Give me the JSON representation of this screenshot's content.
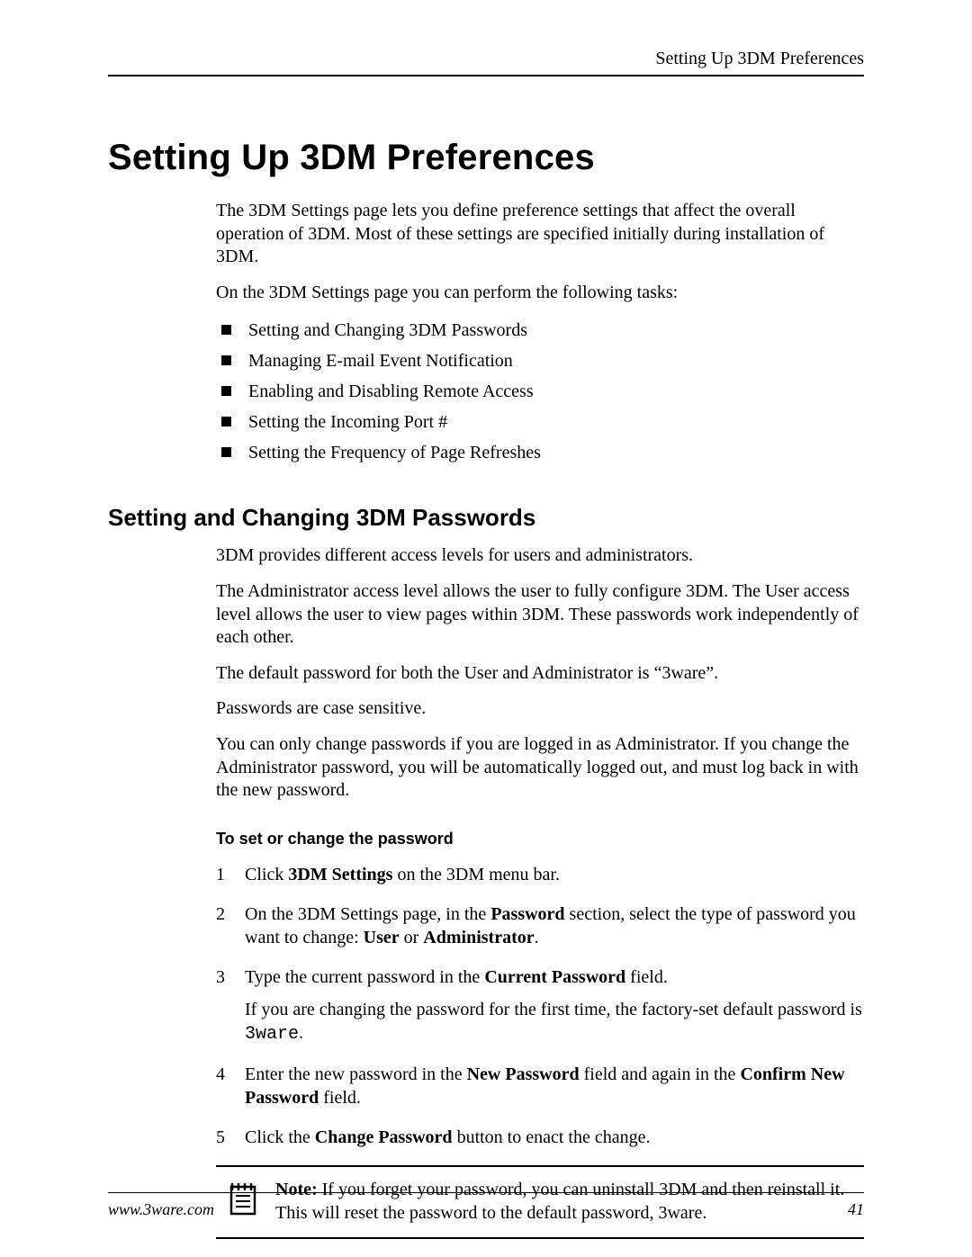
{
  "header": {
    "running": "Setting Up 3DM Preferences"
  },
  "title": "Setting Up 3DM Preferences",
  "intro": {
    "p1": "The 3DM Settings page lets you define preference settings that affect the overall operation of 3DM. Most of these settings are specified initially during installation of 3DM.",
    "p2": "On the 3DM Settings page you can perform the following tasks:"
  },
  "tasks": [
    "Setting and Changing 3DM Passwords",
    "Managing E-mail Event Notification",
    "Enabling and Disabling Remote Access",
    "Setting the Incoming Port #",
    "Setting the Frequency of Page Refreshes"
  ],
  "subsection": {
    "title": "Setting and Changing 3DM Passwords",
    "p1": "3DM provides different access levels for users and administrators.",
    "p2": "The Administrator access level allows the user to fully configure 3DM. The User access level allows the user to view pages within 3DM. These passwords work independently of each other.",
    "p3": "The default password for both the User and Administrator is “3ware”.",
    "p4": "Passwords are case sensitive.",
    "p5": "You can only change passwords if you are logged in as Administrator. If you change the Administrator password, you will be automatically logged out, and must log back in with the new password."
  },
  "procedure": {
    "heading": "To set or change the password",
    "steps": {
      "s1_a": "Click ",
      "s1_b": "3DM Settings",
      "s1_c": " on the 3DM menu bar.",
      "s2_a": "On the 3DM Settings page, in the ",
      "s2_b": "Password",
      "s2_c": " section, select the type of password you want to change: ",
      "s2_d": "User",
      "s2_e": " or ",
      "s2_f": "Administrator",
      "s2_g": ".",
      "s3_a": "Type the current password in the ",
      "s3_b": "Current Password",
      "s3_c": " field.",
      "s3_note_a": "If you are changing the password for the first time, the factory-set default password is ",
      "s3_note_b": "3ware",
      "s3_note_c": ".",
      "s4_a": "Enter the new password in the ",
      "s4_b": "New Password",
      "s4_c": " field and again in the ",
      "s4_d": "Confirm New Password",
      "s4_e": " field.",
      "s5_a": "Click the ",
      "s5_b": "Change Password",
      "s5_c": " button to enact the change."
    }
  },
  "note": {
    "label": "Note:",
    "text": " If you forget your password, you can uninstall 3DM and then reinstall it. This will reset the password to the default password, 3ware."
  },
  "footer": {
    "url": "www.3ware.com",
    "page": "41"
  }
}
